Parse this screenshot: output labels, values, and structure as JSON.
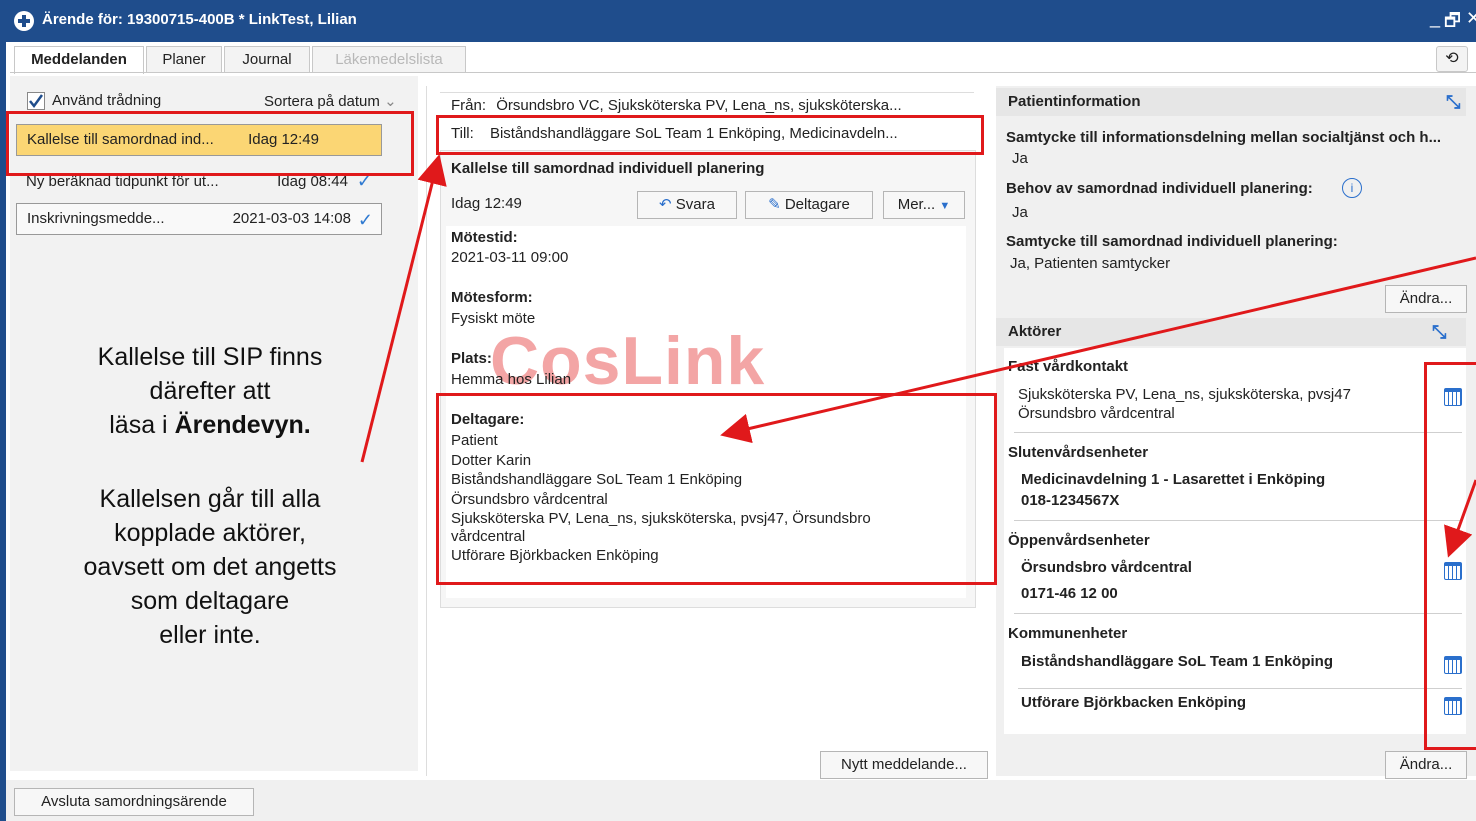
{
  "window": {
    "title": "Ärende för: 19300715-400B * LinkTest, Lilian",
    "controls": [
      "_",
      "🗗",
      "✕"
    ]
  },
  "tabs": [
    {
      "label": "Meddelanden",
      "state": "active"
    },
    {
      "label": "Planer",
      "state": "normal"
    },
    {
      "label": "Journal",
      "state": "normal"
    },
    {
      "label": "Läkemedelslista",
      "state": "disabled"
    }
  ],
  "left": {
    "threading_label": "Använd trådning",
    "threading_checked": true,
    "sort_label": "Sortera på datum",
    "messages": [
      {
        "title": "Kallelse till samordnad ind...",
        "date": "Idag 12:49",
        "read": false,
        "selected": true
      },
      {
        "title": "Ny beräknad tidpunkt för ut...",
        "date": "Idag 08:44",
        "read": true,
        "selected": false
      },
      {
        "title": "Inskrivningsmedde...",
        "date": "2021-03-03 14:08",
        "read": true,
        "selected": false
      }
    ],
    "annotation": {
      "line1": "Kallelse till SIP finns",
      "line2": "därefter att",
      "line3_pre": "läsa i ",
      "line3_bold": "Ärendevyn.",
      "para2": [
        "Kallelsen går till alla",
        "kopplade aktörer,",
        "oavsett om det angetts",
        "som deltagare",
        "eller inte."
      ]
    }
  },
  "message": {
    "from_label": "Från:",
    "from": "Örsundsbro VC, Sjuksköterska PV, Lena_ns, sjuksköterska...",
    "to_label": "Till:",
    "to": "Biståndshandläggare SoL Team 1 Enköping, Medicinavdeln...",
    "subject": "Kallelse till samordnad individuell planering",
    "time": "Idag 12:49",
    "reply_label": "Svara",
    "participants_btn": "Deltagare",
    "more_btn": "Mer...",
    "meeting_time_label": "Mötestid:",
    "meeting_time": "2021-03-11  09:00",
    "meeting_form_label": "Mötesform:",
    "meeting_form": "Fysiskt möte",
    "place_label": "Plats:",
    "place": "Hemma hos Lilian",
    "participants_label": "Deltagare:",
    "participants": [
      "Patient",
      "Dotter Karin",
      "Biståndshandläggare SoL Team 1 Enköping",
      "Örsundsbro vårdcentral",
      "Sjuksköterska PV, Lena_ns, sjuksköterska, pvsj47, Örsundsbro",
      "vårdcentral",
      "Utförare Björkbacken Enköping"
    ],
    "new_message_btn": "Nytt meddelande...",
    "watermark": "CosLink"
  },
  "patient_info": {
    "header": "Patientinformation",
    "consent_info_label": "Samtycke till informationsdelning mellan socialtjänst och h...",
    "consent_info_value": "Ja",
    "need_sip_label": "Behov av samordnad individuell planering:",
    "need_sip_value": "Ja",
    "consent_sip_label": "Samtycke till samordnad individuell planering:",
    "consent_sip_value": "Ja, Patienten samtycker",
    "edit_btn": "Ändra..."
  },
  "actors": {
    "header": "Aktörer",
    "fast_label": "Fast vårdkontakt",
    "fast_line1": "Sjuksköterska PV, Lena_ns, sjuksköterska, pvsj47",
    "fast_line2": "Örsundsbro vårdcentral",
    "sluten_label": "Slutenvårdsenheter",
    "sluten_name": "Medicinavdelning 1 - Lasarettet i Enköping",
    "sluten_phone": "018-1234567X",
    "oppen_label": "Öppenvårdsenheter",
    "oppen_name": "Örsundsbro vårdcentral",
    "oppen_phone": "0171-46 12 00",
    "kommun_label": "Kommunenheter",
    "kommun_1": "Biståndshandläggare SoL Team 1 Enköping",
    "kommun_2": "Utförare Björkbacken Enköping",
    "edit_btn": "Ändra..."
  },
  "bottom": {
    "close_case_btn": "Avsluta samordningsärende"
  },
  "colors": {
    "titlebar": "#1f4d8c",
    "selected_item": "#fbd674",
    "annotation_red": "#e0191b",
    "icon_blue": "#2a6fcc"
  }
}
